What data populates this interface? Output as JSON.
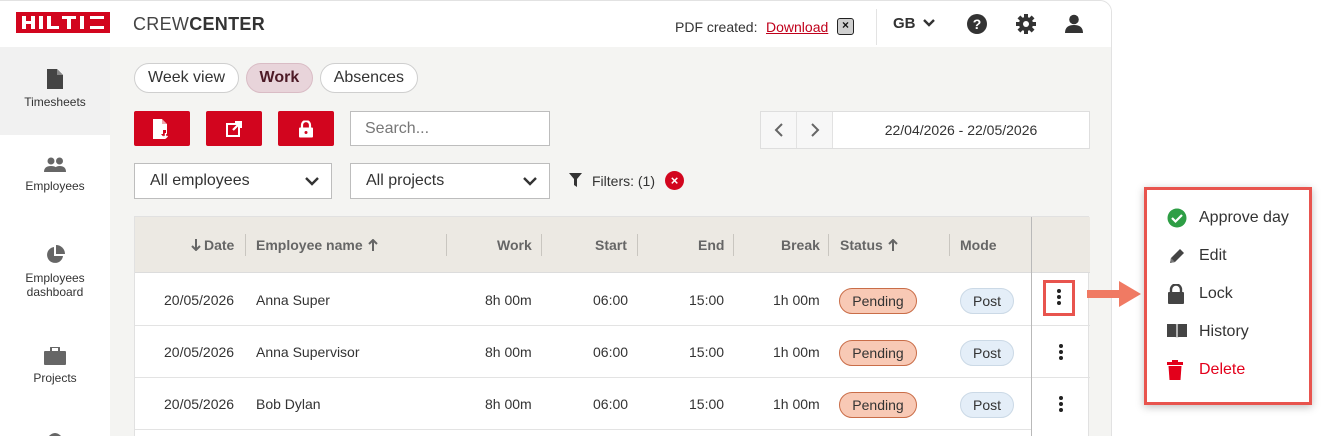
{
  "header": {
    "logo_text": "HILTI",
    "brand_light": "CREW",
    "brand_bold": "CENTER",
    "pdf_label": "PDF created:",
    "pdf_link": "Download",
    "language": "GB"
  },
  "sidebar": {
    "items": [
      {
        "label": "Timesheets",
        "icon": "document-icon",
        "active": true
      },
      {
        "label": "Employees",
        "icon": "people-icon"
      },
      {
        "label": "Employees dashboard",
        "icon": "pie-chart-icon"
      },
      {
        "label": "Projects",
        "icon": "briefcase-icon"
      }
    ]
  },
  "tabs": [
    {
      "label": "Week view"
    },
    {
      "label": "Work",
      "active": true
    },
    {
      "label": "Absences"
    }
  ],
  "search": {
    "placeholder": "Search..."
  },
  "date_range": "22/04/2026 - 22/05/2026",
  "filters": {
    "employee_select": "All employees",
    "project_select": "All projects",
    "filters_label": "Filters: (1)"
  },
  "table": {
    "columns": {
      "date": "Date",
      "employee": "Employee name",
      "work": "Work",
      "start": "Start",
      "end": "End",
      "break": "Break",
      "status": "Status",
      "mode": "Mode"
    },
    "rows": [
      {
        "date": "20/05/2026",
        "employee": "Anna Super",
        "work": "8h 00m",
        "start": "06:00",
        "end": "15:00",
        "break": "1h 00m",
        "status": "Pending",
        "mode": "Post"
      },
      {
        "date": "20/05/2026",
        "employee": "Anna Supervisor",
        "work": "8h 00m",
        "start": "06:00",
        "end": "15:00",
        "break": "1h 00m",
        "status": "Pending",
        "mode": "Post"
      },
      {
        "date": "20/05/2026",
        "employee": "Bob Dylan",
        "work": "8h 00m",
        "start": "06:00",
        "end": "15:00",
        "break": "1h 00m",
        "status": "Pending",
        "mode": "Post"
      }
    ]
  },
  "context_menu": {
    "items": [
      {
        "label": "Approve day",
        "icon": "check-circle-icon"
      },
      {
        "label": "Edit",
        "icon": "pencil-icon"
      },
      {
        "label": "Lock",
        "icon": "lock-icon"
      },
      {
        "label": "History",
        "icon": "book-icon"
      },
      {
        "label": "Delete",
        "icon": "trash-icon"
      }
    ]
  },
  "colors": {
    "brand_red": "#d2051e",
    "highlight": "#e8544e",
    "pending_fill": "#f8c9b5",
    "post_fill": "#e4eef8",
    "approve_green": "#2e9e45"
  }
}
